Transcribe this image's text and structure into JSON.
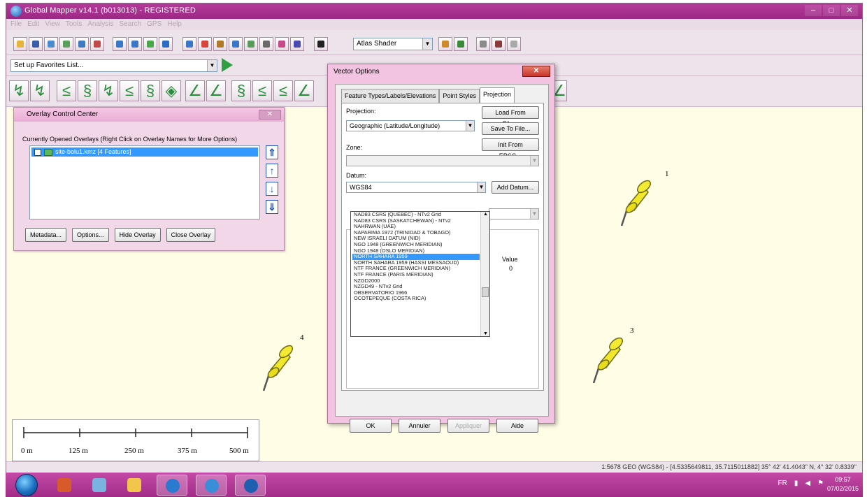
{
  "app": {
    "title": "Global Mapper v14.1 (b013013) - REGISTERED",
    "menu": [
      "File",
      "Edit",
      "View",
      "Tools",
      "Analysis",
      "Search",
      "GPS",
      "Help"
    ],
    "shader": "Atlas Shader",
    "favorites": "Set up Favorites List..."
  },
  "overlay_center": {
    "title": "Overlay Control Center",
    "header": "Currently Opened Overlays (Right Click on Overlay Names for More Options)",
    "items": [
      {
        "label": "site-bolu1.kmz [4 Features]"
      }
    ],
    "buttons": {
      "metadata": "Metadata...",
      "options": "Options...",
      "hide": "Hide Overlay",
      "close": "Close Overlay"
    }
  },
  "vector_options": {
    "title": "Vector Options",
    "tabs": [
      {
        "label": "Feature Types/Labels/Elevations",
        "active": false
      },
      {
        "label": "Point Styles",
        "active": false
      },
      {
        "label": "Projection",
        "active": true
      }
    ],
    "projection_label": "Projection:",
    "projection_value": "Geographic (Latitude/Longitude)",
    "load_btn": "Load From File...",
    "save_btn": "Save To File...",
    "epsg_btn": "Init From EPSG...",
    "zone_label": "Zone:",
    "datum_label": "Datum:",
    "datum_value": "WGS84",
    "add_datum_btn": "Add Datum...",
    "value_header": "Value",
    "value_zero": "0",
    "datum_options": [
      "NAD83 CSRS (QUEBEC) - NTv2 Grid",
      "NAD83 CSRS (SASKATCHEWAN) - NTv2",
      "NAHRWAN (UAE)",
      "NAPARIMA 1972 (TRINIDAD & TOBAGO)",
      "NEW ISRAELI DATUM (NID)",
      "NGO 1948 (GREENWICH MERIDIAN)",
      "NGO 1948 (OSLO MERIDIAN)",
      "NORTH SAHARA 1959",
      "NORTH SAHARA 1959 (HASSI MESSAOUD)",
      "NTF FRANCE (GREENWICH MERIDIAN)",
      "NTF FRANCE (PARIS MERIDIAN)",
      "NZGD2000",
      "NZGD49 - NTv2 Grid",
      "OBSERVATORIO 1966",
      "OCOTEPEQUE (COSTA RICA)"
    ],
    "selected_datum_index": 7,
    "buttons": {
      "ok": "OK",
      "cancel": "Annuler",
      "apply": "Appliquer",
      "help": "Aide"
    }
  },
  "map": {
    "pins": [
      {
        "label": "1"
      },
      {
        "label": "3"
      },
      {
        "label": "4"
      }
    ],
    "scale_labels": [
      "0 m",
      "125 m",
      "250 m",
      "375 m",
      "500 m"
    ]
  },
  "status_text": "1:5678  GEO (WGS84) - [4.5335649811, 35.7115011882]  35° 42' 41.4043\" N, 4° 32' 0.8339\"",
  "taskbar": {
    "tray_lang": "FR",
    "time": "09:57",
    "date": "07/02/2015"
  },
  "colors": {
    "title_bar": "#b53a9a",
    "map_bg": "#fffde5",
    "selection": "#3399ff",
    "pin": "#f0e62a"
  },
  "icons": [
    "app-globe-icon",
    "pushpin-icon",
    "start-orb-icon",
    "arrow-up-icon",
    "arrow-down-icon"
  ]
}
